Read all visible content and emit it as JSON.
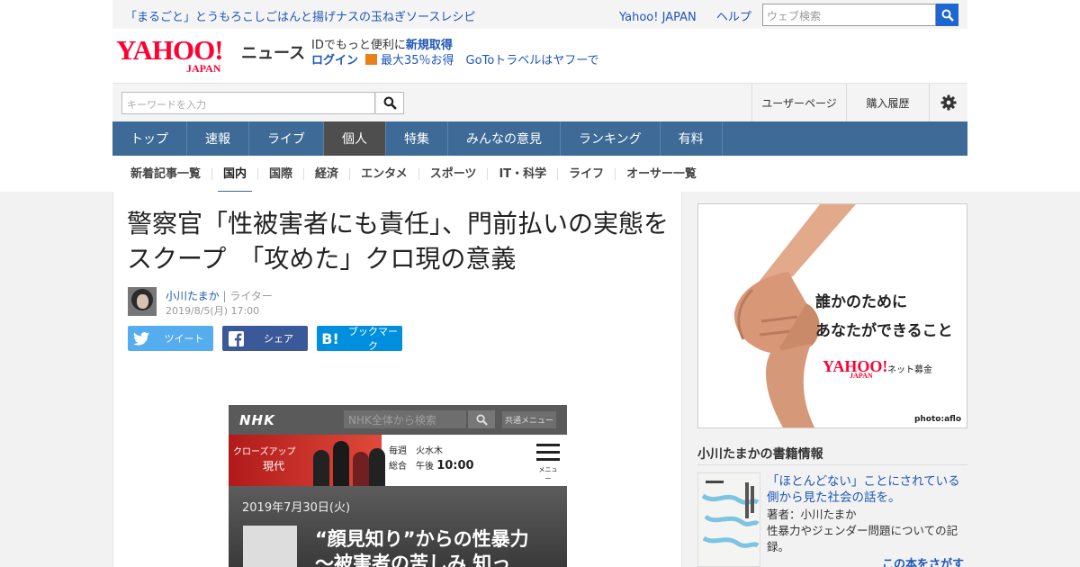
{
  "topbar": {
    "promo": "「まるごと」とうもろこしごはんと揚げナスの玉ねぎソースレシピ",
    "links": [
      "Yahoo! JAPAN",
      "ヘルプ"
    ],
    "web_search_placeholder": "ウェブ検索"
  },
  "masthead": {
    "logo_main": "YAHOO!",
    "logo_sub": "JAPAN",
    "section_label": "ニュース",
    "id_text": "IDでもっと便利に",
    "register_link": "新規取得",
    "login_link": "ログイン",
    "campaign_link": "最大35％お得　GoToトラベルはヤフーで"
  },
  "search": {
    "keyword_placeholder": "キーワードを入力",
    "user_page": "ユーザーページ",
    "purchase_history": "購入履歴"
  },
  "nav": [
    "トップ",
    "速報",
    "ライブ",
    "個人",
    "特集",
    "みんなの意見",
    "ランキング",
    "有料"
  ],
  "nav_active": "個人",
  "subnav": [
    "新着記事一覧",
    "国内",
    "国際",
    "経済",
    "エンタメ",
    "スポーツ",
    "IT・科学",
    "ライフ",
    "オーサー一覧"
  ],
  "subnav_active": "国内",
  "article": {
    "title": "警察官「性被害者にも責任」、門前払いの実態をスクープ　「攻めた」クロ現の意義",
    "author_name": "小川たまか",
    "author_role": "| ライター",
    "date": "2019/8/5(月) 17:00",
    "share_buttons": [
      {
        "label": "ツイート",
        "icon": "twitter-icon",
        "color": "#55acee"
      },
      {
        "label": "シェア",
        "icon": "facebook-icon",
        "color": "#3b5998"
      },
      {
        "label": "ブックマーク",
        "icon": "hatena-bookmark-icon",
        "color": "#008fde"
      }
    ]
  },
  "embedded_screenshot": {
    "logo": "NHK",
    "search_placeholder": "NHK全体から検索",
    "menu_label": "共通メニュー",
    "banner_line1": "クローズアップ",
    "banner_line2": "現代",
    "schedule_weekly": "毎週",
    "schedule_days": "火水木",
    "schedule_channel": "総合",
    "schedule_pm": "午後",
    "schedule_time": "10:00",
    "menu_icon_label": "メニュー",
    "date": "2019年7月30日(火)",
    "headline_line1": "“顔見知り”からの性暴力",
    "headline_line2": "〜被害者の苦しみ 知っ"
  },
  "sidebar": {
    "ad_line1": "誰かのために",
    "ad_line2": "あなたができること",
    "ad_logo": "YAHOO!",
    "ad_logo_sub": "JAPAN",
    "ad_service": "ネット募金",
    "ad_credit": "photo:aflo",
    "book_heading": "小川たまかの書籍情報",
    "book_title": "「ほとんどない」ことにされている側から見た社会の話を。",
    "book_author": "著者：小川たまか",
    "book_desc": "性暴力やジェンダー問題についての記録。",
    "book_more": "この本をさがす"
  },
  "colors": {
    "nav_bg": "#3d6a96",
    "nav_active_bg": "#4e4e4e",
    "link_blue": "#1e56b8",
    "yahoo_red": "#ff0033",
    "search_button": "#1e66d1"
  }
}
